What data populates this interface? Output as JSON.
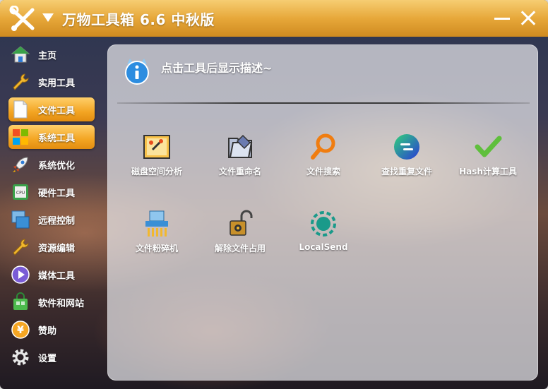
{
  "app": {
    "title": "万物工具箱 6.6 中秋版"
  },
  "sidebar": {
    "items": [
      {
        "label": "主页",
        "icon": "home-icon"
      },
      {
        "label": "实用工具",
        "icon": "wrench-icon"
      },
      {
        "label": "文件工具",
        "icon": "file-icon"
      },
      {
        "label": "系统工具",
        "icon": "windows-logo-icon"
      },
      {
        "label": "系统优化",
        "icon": "rocket-icon"
      },
      {
        "label": "硬件工具",
        "icon": "cpu-icon"
      },
      {
        "label": "远程控制",
        "icon": "remote-screen-icon"
      },
      {
        "label": "资源编辑",
        "icon": "wrench-icon"
      },
      {
        "label": "媒体工具",
        "icon": "play-icon"
      },
      {
        "label": "软件和网站",
        "icon": "shopping-bag-icon"
      },
      {
        "label": "赞助",
        "icon": "yuan-coin-icon"
      },
      {
        "label": "设置",
        "icon": "gear-icon"
      }
    ],
    "active_index": 2
  },
  "main": {
    "description": "点击工具后显示描述~",
    "tools": [
      {
        "label": "磁盘空间分析",
        "icon": "disk-analyzer-icon"
      },
      {
        "label": "文件重命名",
        "icon": "rename-folder-icon"
      },
      {
        "label": "文件搜索",
        "icon": "search-icon"
      },
      {
        "label": "查找重复文件",
        "icon": "duplicate-finder-icon"
      },
      {
        "label": "Hash计算工具",
        "icon": "checkmark-icon"
      },
      {
        "label": "文件粉碎机",
        "icon": "shredder-icon"
      },
      {
        "label": "解除文件占用",
        "icon": "unlock-icon"
      },
      {
        "label": "LocalSend",
        "icon": "localsend-icon"
      }
    ]
  }
}
